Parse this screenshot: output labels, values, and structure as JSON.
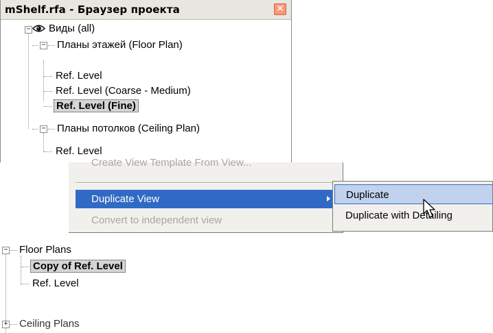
{
  "browser": {
    "title": "mShelf.rfa - Браузер проекта",
    "close_glyph": "✕",
    "tree": {
      "views_root": "Виды (all)",
      "floor_plans": "Планы этажей (Floor Plan)",
      "floor_items": [
        "Ref. Level",
        "Ref. Level (Coarse - Medium)",
        "Ref. Level (Fine)"
      ],
      "ceiling_plans": "Планы потолков (Ceiling Plan)",
      "ceiling_items": [
        "Ref. Level"
      ]
    }
  },
  "context_menu": {
    "items": [
      {
        "label": "Create View Template From View...",
        "enabled": false
      },
      {
        "label": "Duplicate View",
        "enabled": true,
        "highlighted": true,
        "has_submenu": true
      },
      {
        "label": "Convert to independent view",
        "enabled": false
      }
    ]
  },
  "submenu": {
    "items": [
      {
        "label": "Duplicate",
        "highlighted": true
      },
      {
        "label": "Duplicate with Detailing",
        "highlighted": false
      }
    ]
  },
  "result_tree": {
    "floor_plans": "Floor Plans",
    "items": [
      "Copy of Ref. Level",
      "Ref. Level"
    ],
    "ceiling_plans": "Ceiling Plans"
  },
  "colors": {
    "menu_highlight": "#316ac5",
    "submenu_highlight": "#c1d2ee",
    "menu_bg": "#f1f0ec",
    "close_button": "#f59a79"
  },
  "icons": [
    "eye-icon",
    "close-icon",
    "expand-toggle-icon",
    "submenu-arrow-icon",
    "mouse-cursor-icon"
  ]
}
